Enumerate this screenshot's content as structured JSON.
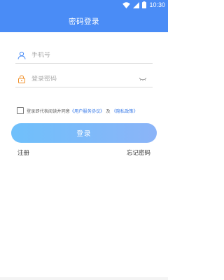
{
  "status_bar": {
    "time": "10:30",
    "icons": [
      "wifi-icon",
      "signal-icon",
      "battery-icon"
    ],
    "color": "#4a8cf6"
  },
  "header": {
    "title": "密码登录",
    "background": "#4a8cf6"
  },
  "form": {
    "phone": {
      "placeholder": "手机号",
      "value": "",
      "icon": "user-icon"
    },
    "password": {
      "placeholder": "登录密码",
      "value": "",
      "icon": "lock-icon",
      "toggle_icon": "eye-closed-icon"
    }
  },
  "agreement": {
    "checked": false,
    "text": "登录即代表阅读并同意",
    "user_agreement_link": "《用户服务协议》",
    "conjunction": "及",
    "privacy_link": "《隐私政策》",
    "link_color": "#3a7be8"
  },
  "actions": {
    "login_label": "登录",
    "register_label": "注册",
    "forgot_label": "忘记密码"
  }
}
